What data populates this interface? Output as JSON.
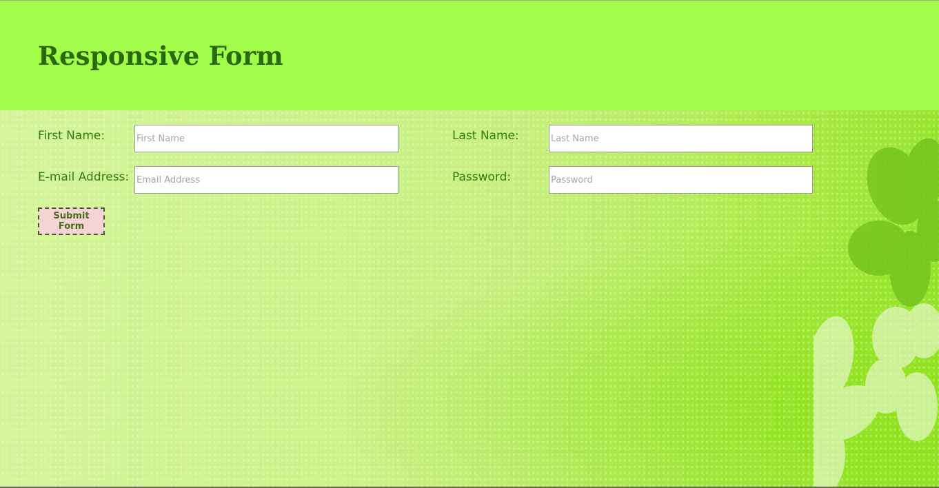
{
  "header": {
    "title": "Responsive Form"
  },
  "form": {
    "first_name": {
      "label": "First Name:",
      "placeholder": "First Name"
    },
    "last_name": {
      "label": "Last Name:",
      "placeholder": "Last Name"
    },
    "email": {
      "label": "E-mail Address:",
      "placeholder": "Email Address"
    },
    "password": {
      "label": "Password:",
      "placeholder": "Password"
    },
    "submit_label": "Submit Form"
  },
  "colors": {
    "header_bg": "#a2fe4a",
    "title": "#2a6a0b",
    "label": "#2f7d0c",
    "button_bg": "#f4d5d3"
  }
}
